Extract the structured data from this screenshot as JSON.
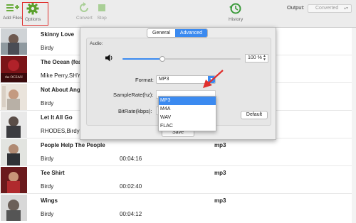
{
  "toolbar": {
    "add_files_label": "Add Files",
    "options_label": "Options",
    "convert_label": "Convert",
    "stop_label": "Stop",
    "history_label": "History",
    "output_label": "Output:",
    "output_value": "Converted"
  },
  "songs": [
    {
      "title": "Skinny Love",
      "artist": "Birdy",
      "duration": "",
      "format": ""
    },
    {
      "title": "The Ocean (fea",
      "artist": "Mike Perry,SHY",
      "duration": "",
      "format": ""
    },
    {
      "title": "Not About Ang",
      "artist": "Birdy",
      "duration": "",
      "format": ""
    },
    {
      "title": "Let It All Go",
      "artist": "RHODES,Birdy",
      "duration": "",
      "format": ""
    },
    {
      "title": "People Help The People",
      "artist": "Birdy",
      "duration": "00:04:16",
      "format": "mp3"
    },
    {
      "title": "Tee Shirt",
      "artist": "Birdy",
      "duration": "00:02:40",
      "format": "mp3"
    },
    {
      "title": "Wings",
      "artist": "Birdy",
      "duration": "00:04:12",
      "format": "mp3"
    }
  ],
  "thumb_texts": {
    "ocean": "the OCEAN"
  },
  "dialog": {
    "tabs": [
      "General",
      "Advanced"
    ],
    "active_tab": "Advanced",
    "audio_group_label": "Audio:",
    "volume_value": "100 %",
    "volume_fraction": 0.34,
    "format_label": "Format:",
    "format_value": "MP3",
    "samplerate_label": "SampleRate(hz):",
    "bitrate_label": "BitRate(kbps):",
    "format_options": [
      "MP3",
      "M4A",
      "WAV",
      "FLAC"
    ],
    "selected_option": "MP3",
    "default_button": "Default",
    "save_button": "Save"
  },
  "colors": {
    "accent": "#3b8af0",
    "highlight_box": "#e0302e",
    "options_icon": "#5aa02c",
    "history_icon": "#3a9a3a"
  }
}
